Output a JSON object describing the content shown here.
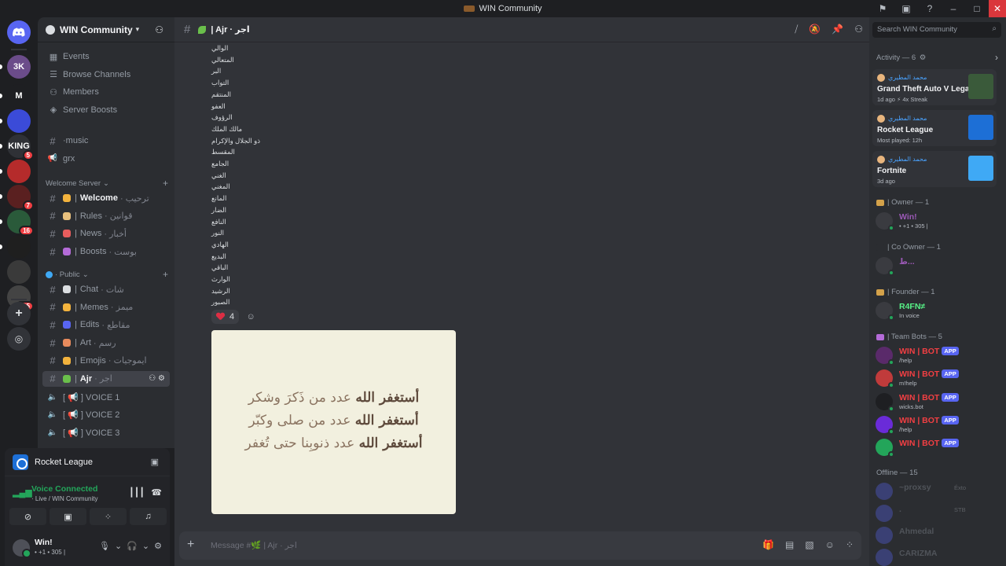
{
  "window": {
    "title": "WIN Community"
  },
  "server": {
    "name": "WIN Community"
  },
  "rail_servers": [
    {
      "label": "3K",
      "color": "#6b4c8a",
      "badge": ""
    },
    {
      "label": "M",
      "color": "#1e1f22",
      "badge": ""
    },
    {
      "label": "",
      "color": "#3b4bd8",
      "badge": ""
    },
    {
      "label": "KING",
      "color": "#2f3136",
      "badge": "5"
    },
    {
      "label": "",
      "color": "#b52b2b",
      "badge": ""
    },
    {
      "label": "",
      "color": "#5a2020",
      "badge": "7"
    },
    {
      "label": "",
      "color": "#2a5a3a",
      "badge": "16"
    },
    {
      "label": "",
      "color": "#1f1f1f",
      "badge": ""
    },
    {
      "label": "",
      "color": "#3a3a3a",
      "badge": ""
    },
    {
      "label": "",
      "color": "#444",
      "badge": "125"
    }
  ],
  "sidebar": {
    "nav": [
      {
        "label": "Events",
        "icon": "calendar-icon"
      },
      {
        "label": "Browse Channels",
        "icon": "browse-icon"
      },
      {
        "label": "Members",
        "icon": "members-icon"
      },
      {
        "label": "Server Boosts",
        "icon": "boost-icon"
      }
    ],
    "top_channels": [
      {
        "name": "·music",
        "type": "text"
      },
      {
        "name": "grx",
        "type": "announce"
      }
    ],
    "categories": [
      {
        "label": "Welcome Server"
      },
      {
        "label": "· Public"
      }
    ],
    "welcome_channels": [
      {
        "name": "Welcome",
        "tail": "· ترحيب",
        "emoji_color": "#f3b33d",
        "unread": true
      },
      {
        "name": "Rules",
        "tail": "· قوانين",
        "emoji_color": "#e8c07d",
        "unread": false
      },
      {
        "name": "News",
        "tail": "· أخبار",
        "emoji_color": "#e85d5d",
        "unread": false
      },
      {
        "name": "Boosts",
        "tail": "· بوست",
        "emoji_color": "#b46bd8",
        "unread": false
      }
    ],
    "public_channels": [
      {
        "name": "Chat",
        "tail": "· شات",
        "emoji_color": "#dbdee1",
        "active": false
      },
      {
        "name": "Memes",
        "tail": "· ميمز",
        "emoji_color": "#f3b33d",
        "active": false
      },
      {
        "name": "Edits",
        "tail": "· مقاطع",
        "emoji_color": "#5865f2",
        "active": false
      },
      {
        "name": "Art",
        "tail": "· رسم",
        "emoji_color": "#e88b5d",
        "active": false
      },
      {
        "name": "Emojis",
        "tail": "· ايموجيات",
        "emoji_color": "#f3b33d",
        "active": false
      },
      {
        "name": "Ajr",
        "tail": "· اجر",
        "emoji_color": "#6abf4b",
        "active": true
      }
    ],
    "voice_channels": [
      {
        "name": "[ 📢 ] VOICE 1"
      },
      {
        "name": "[ 📢 ] VOICE 2"
      },
      {
        "name": "[ 📢 ] VOICE 3"
      }
    ]
  },
  "voice_panel": {
    "activity": "Rocket League",
    "status": "Voice Connected",
    "sub": "· Live / WIN Community"
  },
  "user": {
    "name": "Win!",
    "status": "• +1 • 305 |"
  },
  "channel_header": {
    "name": "| Ajr · اجر"
  },
  "message": {
    "names": [
      "الوالي",
      "المتعالي",
      "البر",
      "التواب",
      "المنتقم",
      "العفو",
      "الرؤوف",
      "مالك الملك",
      "ذو الجلال والإكرام",
      "المقسط",
      "الجامع",
      "الغني",
      "المغني",
      "المانع",
      "الضار",
      "النافع",
      "النور",
      "الهادي",
      "البديع",
      "الباقي",
      "الوارث",
      "الرشيد",
      "الصبور"
    ],
    "reaction_count": "4",
    "image_lines": [
      {
        "bold": "أستغفر الله",
        "rest": " عدد من ذَكرَ وشكر"
      },
      {
        "bold": "أستغفر الله",
        "rest": " عدد من صلى وكبّر"
      },
      {
        "bold": "أستغفر الله",
        "rest": " عدد ذنوبِنا حتى تُغفر"
      }
    ]
  },
  "composer": {
    "placeholder": "Message #🌿 | Ajr · اجر"
  },
  "search": {
    "placeholder": "Search WIN Community"
  },
  "activity": {
    "header": "Activity — 6",
    "cards": [
      {
        "user": "محمد المطيري",
        "game": "Grand Theft Auto V Legacy",
        "meta": "1d ago  ⚡ 4x Streak",
        "art_color": "#3a5a3a"
      },
      {
        "user": "محمد المطيري",
        "game": "Rocket League",
        "meta": "Most played: 12h",
        "art_color": "#1d6fd6"
      },
      {
        "user": "محمد المطيري",
        "game": "Fortnite",
        "meta": "3d ago",
        "art_color": "#3fa9f5"
      }
    ]
  },
  "member_groups": {
    "owner": {
      "label": "| Owner — 1",
      "members": [
        {
          "name": "Win!",
          "status": "• +1 • 305 |",
          "color": "#9b59b6"
        }
      ]
    },
    "co_owner": {
      "label": "| Co Owner — 1",
      "members": [
        {
          "name": "ط...",
          "status": "",
          "color": "#9b59b6"
        }
      ]
    },
    "founder": {
      "label": "| Founder — 1",
      "members": [
        {
          "name": "R4FN≠",
          "status": "In voice",
          "color": "#57f287"
        }
      ]
    },
    "team_bots": {
      "label": "| Team Bots — 5",
      "members": [
        {
          "name": "WIN | BOT",
          "status": "/help",
          "color": "#f23f43"
        },
        {
          "name": "WIN | BOT",
          "status": "m!help",
          "color": "#f23f43"
        },
        {
          "name": "WIN | BOT",
          "status": "wicks.bot",
          "color": "#f23f43"
        },
        {
          "name": "WIN | BOT",
          "status": "/help",
          "color": "#f23f43"
        },
        {
          "name": "WIN | BOT",
          "status": "",
          "color": "#f23f43"
        }
      ]
    },
    "offline": {
      "label": "Offline — 15",
      "members": [
        {
          "name": "~proxsy",
          "status": "Éxto"
        },
        {
          "name": ".",
          "status": "STB"
        },
        {
          "name": "Ahmedal",
          "status": ""
        },
        {
          "name": "CARIZMA",
          "status": ""
        }
      ]
    }
  },
  "app_tag": "APP",
  "colors": {
    "accent": "#5865f2",
    "online": "#23a55a",
    "danger": "#f23f43"
  }
}
